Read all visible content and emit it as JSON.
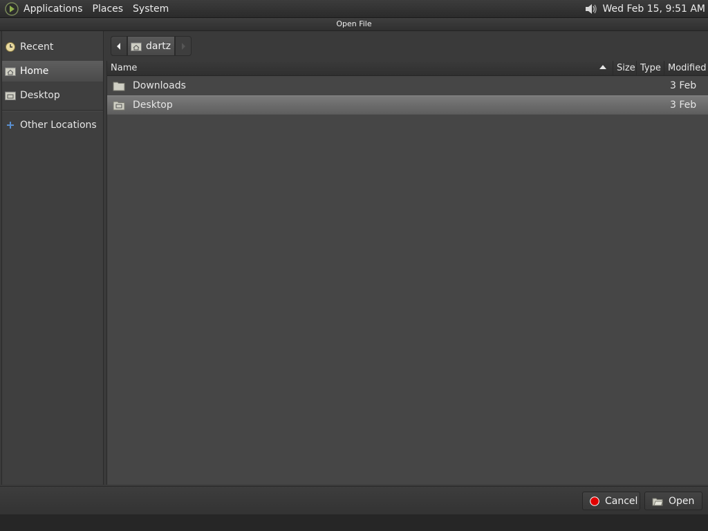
{
  "top_panel": {
    "menus": [
      "Applications",
      "Places",
      "System"
    ],
    "clock": "Wed Feb 15,  9:51 AM",
    "icons": {
      "logo": "distro-logo-icon",
      "volume": "speaker-icon"
    }
  },
  "dialog": {
    "title": "Open File"
  },
  "sidebar": {
    "items": [
      {
        "label": "Recent",
        "icon": "recent-clock-icon"
      },
      {
        "label": "Home",
        "icon": "home-folder-icon",
        "selected": true
      },
      {
        "label": "Desktop",
        "icon": "desktop-folder-icon"
      },
      {
        "label": "Other Locations",
        "icon": "plus-icon"
      }
    ]
  },
  "pathbar": {
    "current": "dartz"
  },
  "file_list": {
    "columns": [
      "Name",
      "Size",
      "Type",
      "Modified"
    ],
    "sort": "name-ascending",
    "rows": [
      {
        "name": "Downloads",
        "size": "",
        "type": "",
        "modified": "3 Feb",
        "icon": "folder-icon"
      },
      {
        "name": "Desktop",
        "size": "",
        "type": "",
        "modified": "3 Feb",
        "icon": "desktop-folder-icon",
        "selected": true
      }
    ]
  },
  "buttons": {
    "cancel": "Cancel",
    "open": "Open"
  },
  "colors": {
    "background": "#3a3a3a",
    "selection": "#6e6e6e",
    "cancel_icon": "#e00000"
  }
}
